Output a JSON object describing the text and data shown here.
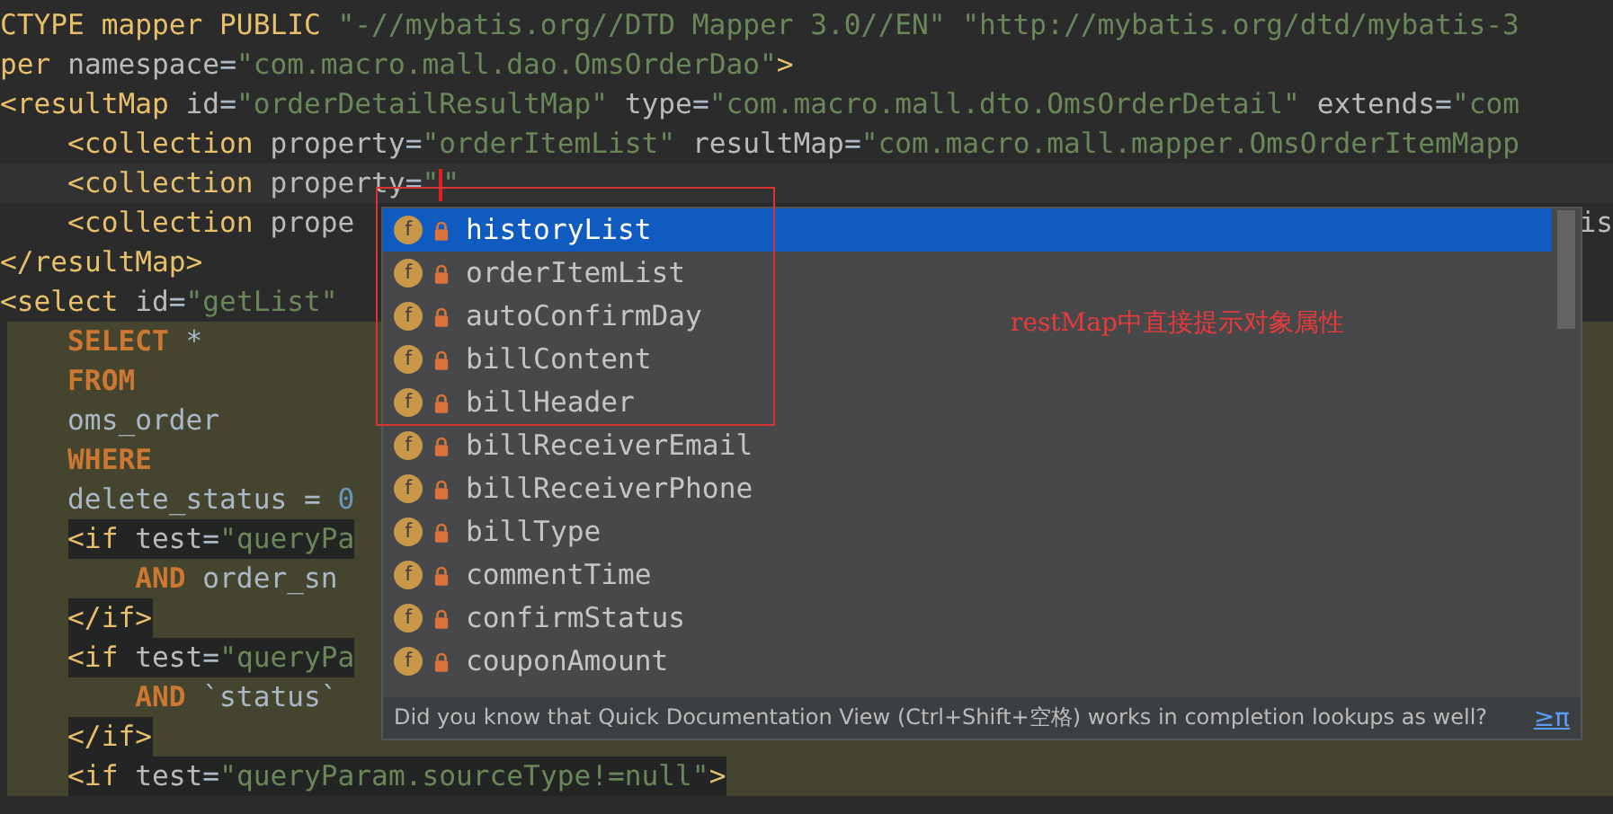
{
  "editor": {
    "lines": [
      {
        "kind": "plain",
        "tokens": [
          {
            "kind": "tag",
            "text": "CTYPE mapper PUBLIC "
          },
          {
            "kind": "str",
            "text": "\"-//mybatis.org//DTD Mapper 3.0//EN\" \"http://mybatis.org/dtd/mybatis-3"
          }
        ]
      },
      {
        "kind": "plain",
        "tokens": [
          {
            "kind": "tag",
            "text": "per "
          },
          {
            "kind": "attr",
            "text": "namespace"
          },
          {
            "kind": "eq",
            "text": "="
          },
          {
            "kind": "str",
            "text": "\"com.macro.mall.dao.OmsOrderDao\""
          },
          {
            "kind": "tag",
            "text": ">"
          }
        ]
      },
      {
        "kind": "plain",
        "tokens": [
          {
            "kind": "tag",
            "text": "<resultMap "
          },
          {
            "kind": "attr",
            "text": "id"
          },
          {
            "kind": "eq",
            "text": "="
          },
          {
            "kind": "str",
            "text": "\"orderDetailResultMap\" "
          },
          {
            "kind": "attr",
            "text": "type"
          },
          {
            "kind": "eq",
            "text": "="
          },
          {
            "kind": "str",
            "text": "\"com.macro.mall.dto.OmsOrderDetail\" "
          },
          {
            "kind": "attr",
            "text": "extends"
          },
          {
            "kind": "eq",
            "text": "="
          },
          {
            "kind": "str",
            "text": "\"com"
          }
        ]
      },
      {
        "kind": "nested",
        "tokens": [
          {
            "kind": "tag",
            "text": "<collection "
          },
          {
            "kind": "attr",
            "text": "property"
          },
          {
            "kind": "eq",
            "text": "="
          },
          {
            "kind": "str",
            "text": "\"orderItemList\" "
          },
          {
            "kind": "attr",
            "text": "resultMap"
          },
          {
            "kind": "eq",
            "text": "="
          },
          {
            "kind": "str",
            "text": "\"com.macro.mall.mapper.OmsOrderItemMapp"
          }
        ]
      },
      {
        "kind": "current",
        "tokens": [
          {
            "kind": "tag",
            "text": "<collection "
          },
          {
            "kind": "attr",
            "text": "property"
          },
          {
            "kind": "eq",
            "text": "="
          },
          {
            "kind": "str",
            "text": "\""
          },
          {
            "kind": "caret"
          },
          {
            "kind": "str",
            "text": "\""
          }
        ]
      },
      {
        "kind": "nested",
        "tokens": [
          {
            "kind": "tag",
            "text": "<collection "
          },
          {
            "kind": "attr",
            "text": "prope"
          }
        ],
        "right_fragment": "is"
      },
      {
        "kind": "plain",
        "tokens": [
          {
            "kind": "tag",
            "text": "</resultMap>"
          }
        ]
      },
      {
        "kind": "plain",
        "tokens": [
          {
            "kind": "tag",
            "text": "<select "
          },
          {
            "kind": "attr",
            "text": "id"
          },
          {
            "kind": "eq",
            "text": "="
          },
          {
            "kind": "str",
            "text": "\"getList\""
          }
        ]
      },
      {
        "kind": "sql",
        "tokens": [
          {
            "kind": "kw",
            "text": "SELECT"
          },
          {
            "kind": "text",
            "text": " *"
          }
        ]
      },
      {
        "kind": "sql",
        "tokens": [
          {
            "kind": "kw",
            "text": "FROM"
          }
        ]
      },
      {
        "kind": "sql",
        "tokens": [
          {
            "kind": "text",
            "text": "oms_order"
          }
        ]
      },
      {
        "kind": "sql",
        "tokens": [
          {
            "kind": "kw",
            "text": "WHERE"
          }
        ]
      },
      {
        "kind": "sql",
        "tokens": [
          {
            "kind": "text",
            "text": "delete_status = "
          },
          {
            "kind": "num",
            "text": "0"
          }
        ]
      },
      {
        "kind": "tag",
        "tokens": [
          {
            "kind": "tag",
            "text": "<if "
          },
          {
            "kind": "attr",
            "text": "test"
          },
          {
            "kind": "eq",
            "text": "="
          },
          {
            "kind": "str",
            "text": "\"queryPa"
          }
        ]
      },
      {
        "kind": "sql-deep",
        "tokens": [
          {
            "kind": "kw",
            "text": "AND"
          },
          {
            "kind": "text",
            "text": " order_sn"
          }
        ]
      },
      {
        "kind": "tag",
        "tokens": [
          {
            "kind": "tag",
            "text": "</if>"
          }
        ]
      },
      {
        "kind": "tag",
        "tokens": [
          {
            "kind": "tag",
            "text": "<if "
          },
          {
            "kind": "attr",
            "text": "test"
          },
          {
            "kind": "eq",
            "text": "="
          },
          {
            "kind": "str",
            "text": "\"queryPa"
          }
        ]
      },
      {
        "kind": "sql-deep",
        "tokens": [
          {
            "kind": "kw",
            "text": "AND"
          },
          {
            "kind": "text",
            "text": " `status`"
          }
        ]
      },
      {
        "kind": "tag",
        "tokens": [
          {
            "kind": "tag",
            "text": "</if>"
          }
        ]
      },
      {
        "kind": "tag",
        "tokens": [
          {
            "kind": "tag",
            "text": "<if "
          },
          {
            "kind": "attr",
            "text": "test"
          },
          {
            "kind": "eq",
            "text": "="
          },
          {
            "kind": "str",
            "text": "\"queryParam.sourceType!=null\""
          },
          {
            "kind": "tag",
            "text": ">"
          }
        ]
      }
    ]
  },
  "completion": {
    "items": [
      {
        "badge": "f",
        "name": "historyList",
        "selected": true
      },
      {
        "badge": "f",
        "name": "orderItemList",
        "selected": false
      },
      {
        "badge": "f",
        "name": "autoConfirmDay",
        "selected": false
      },
      {
        "badge": "f",
        "name": "billContent",
        "selected": false
      },
      {
        "badge": "f",
        "name": "billHeader",
        "selected": false
      },
      {
        "badge": "f",
        "name": "billReceiverEmail",
        "selected": false
      },
      {
        "badge": "f",
        "name": "billReceiverPhone",
        "selected": false
      },
      {
        "badge": "f",
        "name": "billType",
        "selected": false
      },
      {
        "badge": "f",
        "name": "commentTime",
        "selected": false
      },
      {
        "badge": "f",
        "name": "confirmStatus",
        "selected": false
      },
      {
        "badge": "f",
        "name": "couponAmount",
        "selected": false
      }
    ],
    "tip": "Did you know that Quick Documentation View (Ctrl+Shift+空格) works in completion lookups as well?",
    "tip_link": "≥π"
  },
  "annotation": {
    "text": "restMap中直接提示对象属性"
  }
}
